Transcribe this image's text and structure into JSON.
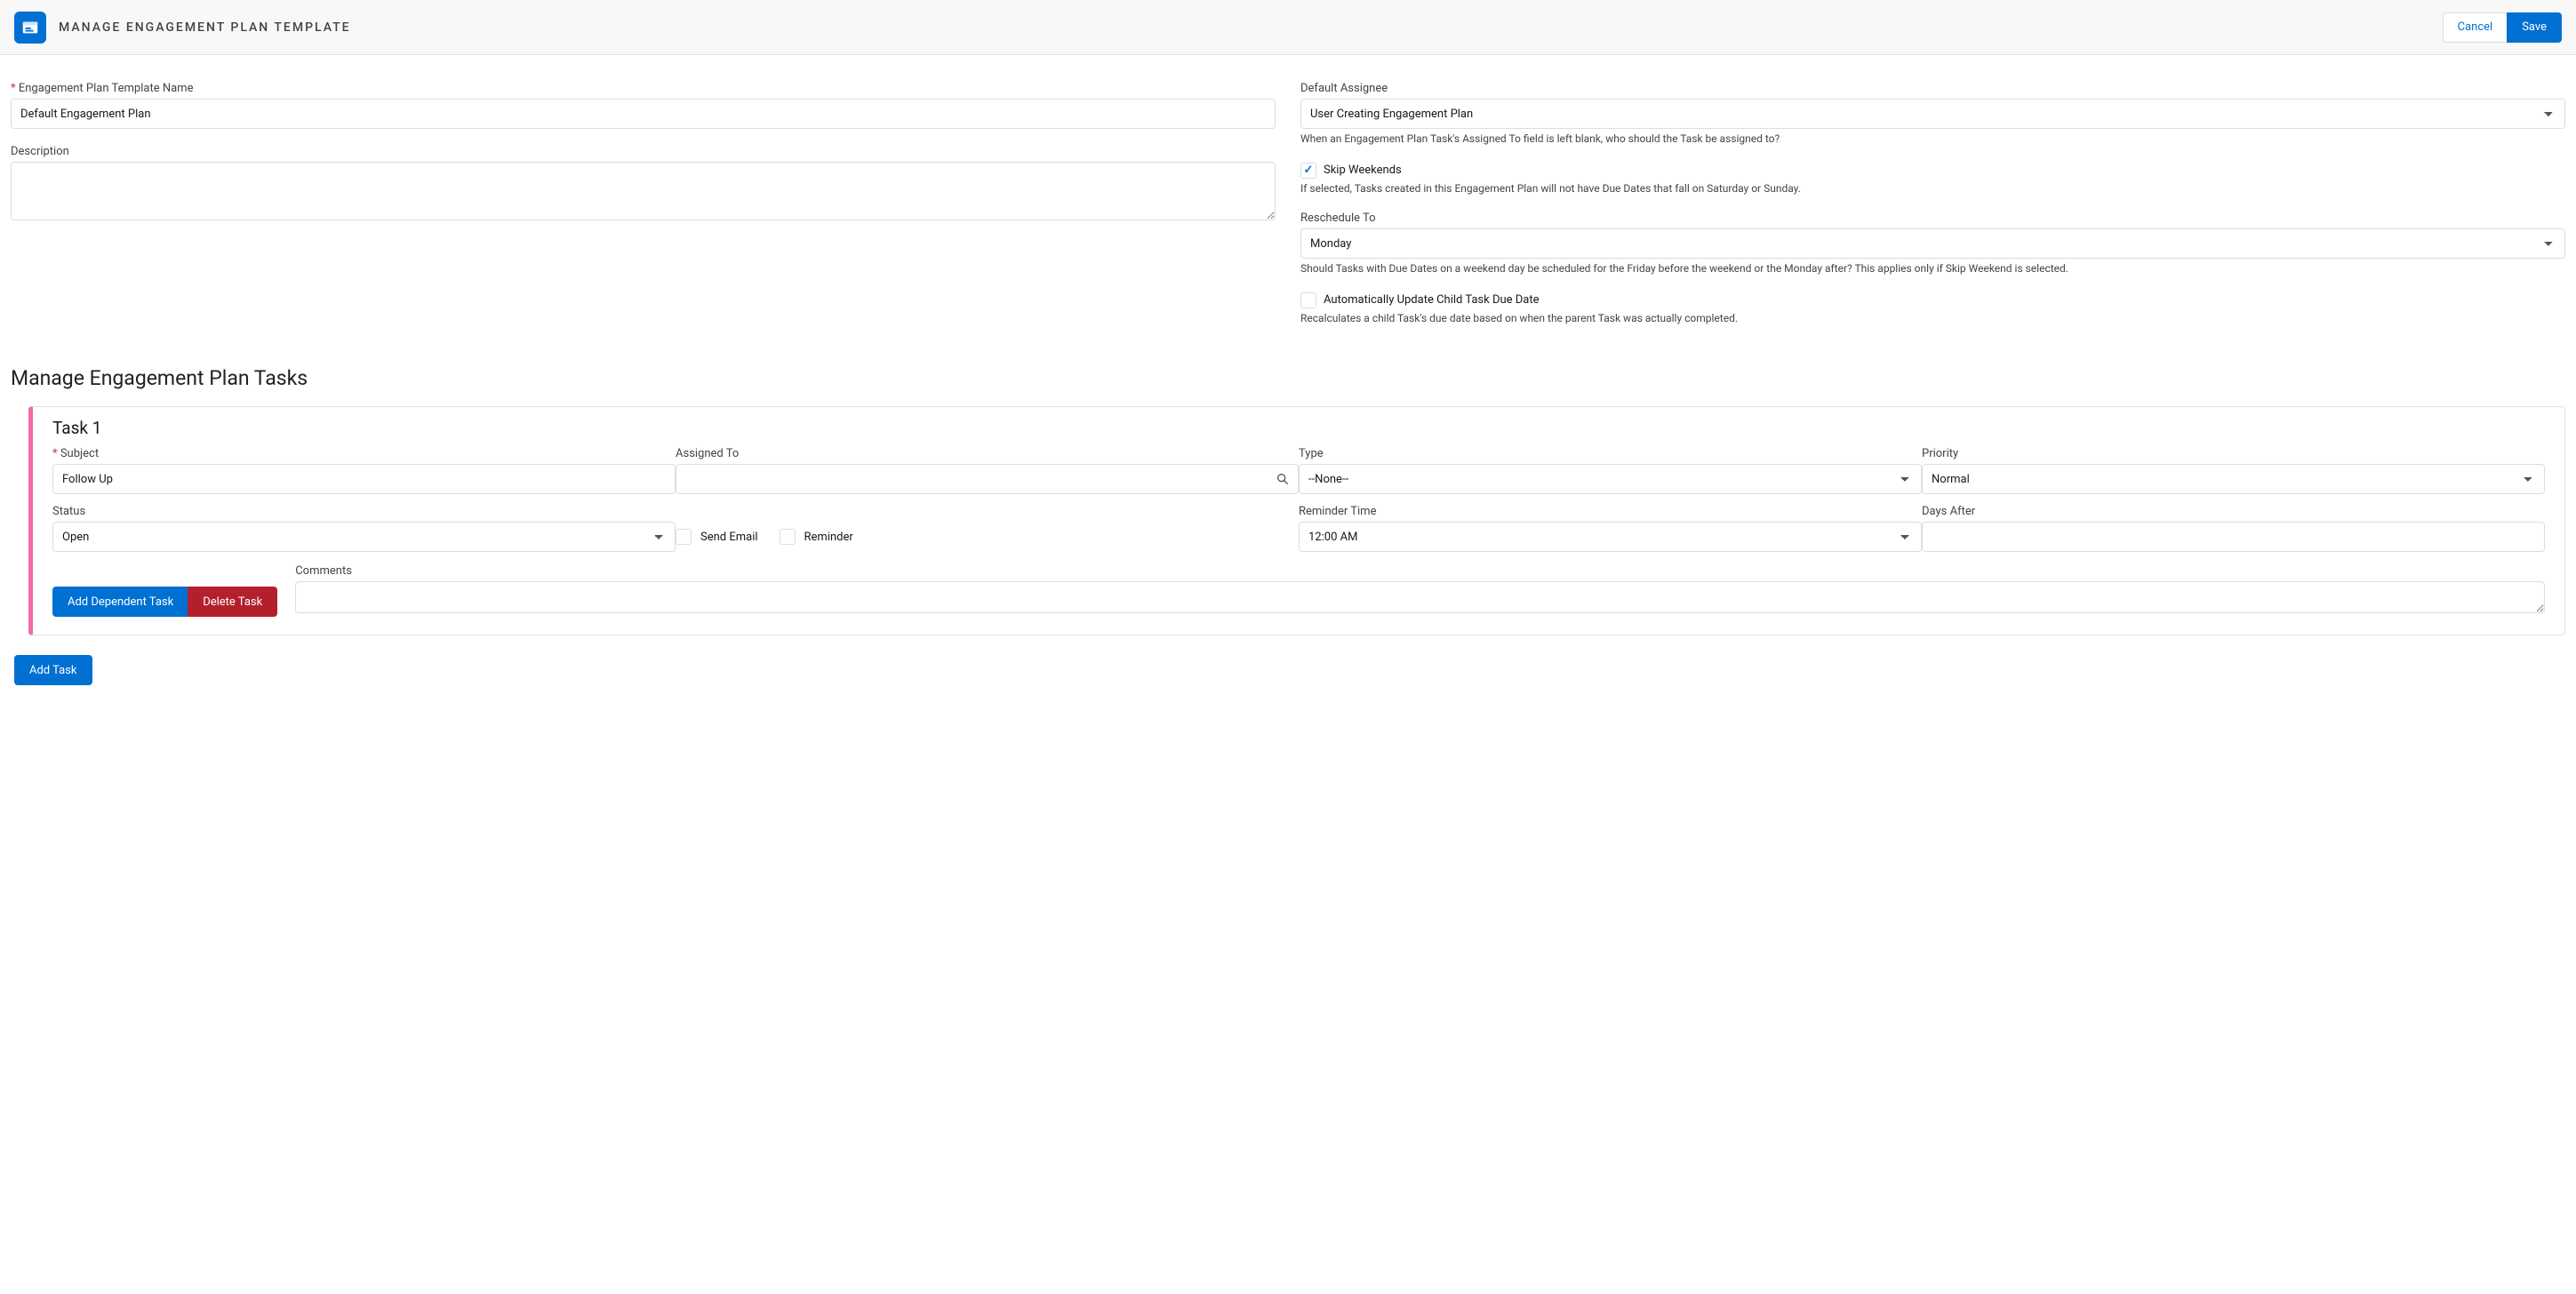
{
  "header": {
    "title": "MANAGE ENGAGEMENT PLAN TEMPLATE",
    "cancel": "Cancel",
    "save": "Save"
  },
  "form": {
    "name_label": "Engagement Plan Template Name",
    "name_value": "Default Engagement Plan",
    "desc_label": "Description",
    "desc_value": "",
    "assignee_label": "Default Assignee",
    "assignee_value": "User Creating Engagement Plan",
    "assignee_help": "When an Engagement Plan Task's Assigned To field is left blank, who should the Task be assigned to?",
    "skip_label": "Skip Weekends",
    "skip_help": "If selected, Tasks created in this Engagement Plan will not have Due Dates that fall on Saturday or Sunday.",
    "resched_label": "Reschedule To",
    "resched_value": "Monday",
    "resched_help": "Should Tasks with Due Dates on a weekend day be scheduled for the Friday before the weekend or the Monday after? This applies only if Skip Weekend is selected.",
    "autoupd_label": "Automatically Update Child Task Due Date",
    "autoupd_help": "Recalculates a child Task's due date based on when the parent Task was actually completed."
  },
  "tasks_section_title": "Manage Engagement Plan Tasks",
  "task": {
    "title": "Task 1",
    "subject_label": "Subject",
    "subject_value": "Follow Up",
    "assigned_label": "Assigned To",
    "assigned_value": "",
    "type_label": "Type",
    "type_value": "--None--",
    "priority_label": "Priority",
    "priority_value": "Normal",
    "status_label": "Status",
    "status_value": "Open",
    "sendemail_label": "Send Email",
    "reminder_label": "Reminder",
    "remtime_label": "Reminder Time",
    "remtime_value": "12:00 AM",
    "days_label": "Days After",
    "days_value": "",
    "comments_label": "Comments",
    "comments_value": "",
    "add_dep": "Add Dependent Task",
    "delete": "Delete Task"
  },
  "add_task": "Add Task"
}
